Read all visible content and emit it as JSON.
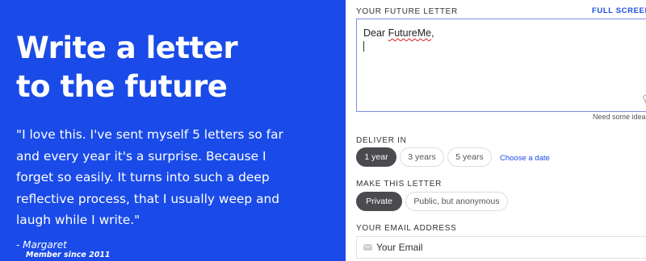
{
  "hero": {
    "title_line1": "Write a letter",
    "title_line2": "to the future",
    "quote_lines": [
      "\"I love this. I've sent myself 5 letters so far",
      "and every year it's a surprise. Because I",
      "forget so easily. It turns into such a deep",
      "reflective process, that I usually weep and",
      "laugh while I write.\""
    ],
    "author": "- Margaret",
    "member_since": "Member since 2011",
    "background_color": "#1a4be8"
  },
  "letter": {
    "label": "YOUR FUTURE LETTER",
    "fullscreen_label": "FULL SCREEN",
    "fullscreen_icon": "expand-icon",
    "greeting_prefix": "Dear ",
    "greeting_name": "FutureMe",
    "greeting_suffix": ",",
    "ideas_link": "Need some ideas"
  },
  "deliver": {
    "label": "DELIVER IN",
    "options": [
      "1 year",
      "3 years",
      "5 years"
    ],
    "selected": "1 year",
    "choose_date": "Choose a date"
  },
  "privacy": {
    "label": "MAKE THIS LETTER",
    "options": [
      "Private",
      "Public, but anonymous"
    ],
    "selected": "Private"
  },
  "email": {
    "label": "YOUR EMAIL ADDRESS",
    "placeholder": "Your Email",
    "icon": "mail-icon"
  },
  "colors": {
    "accent": "#1a4be8",
    "selected_pill": "#4a4a4f"
  }
}
